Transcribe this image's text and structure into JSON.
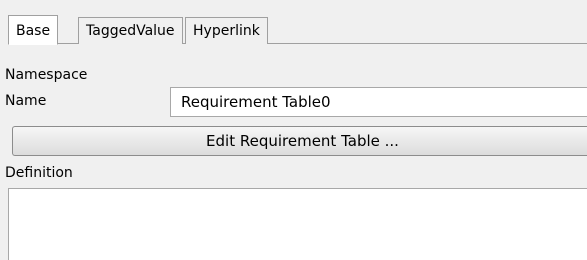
{
  "tabs": [
    {
      "label": "Base",
      "active": true
    },
    {
      "label": "TaggedValue",
      "active": false
    },
    {
      "label": "Hyperlink",
      "active": false
    }
  ],
  "form": {
    "namespace_label": "Namespace",
    "name_label": "Name",
    "name_value": "Requirement Table0",
    "edit_button_label": "Edit Requirement Table ...",
    "definition_label": "Definition",
    "definition_value": ""
  },
  "colors": {
    "background": "#f0f0f0",
    "field_background": "#ffffff",
    "border": "#a0a0a0"
  }
}
